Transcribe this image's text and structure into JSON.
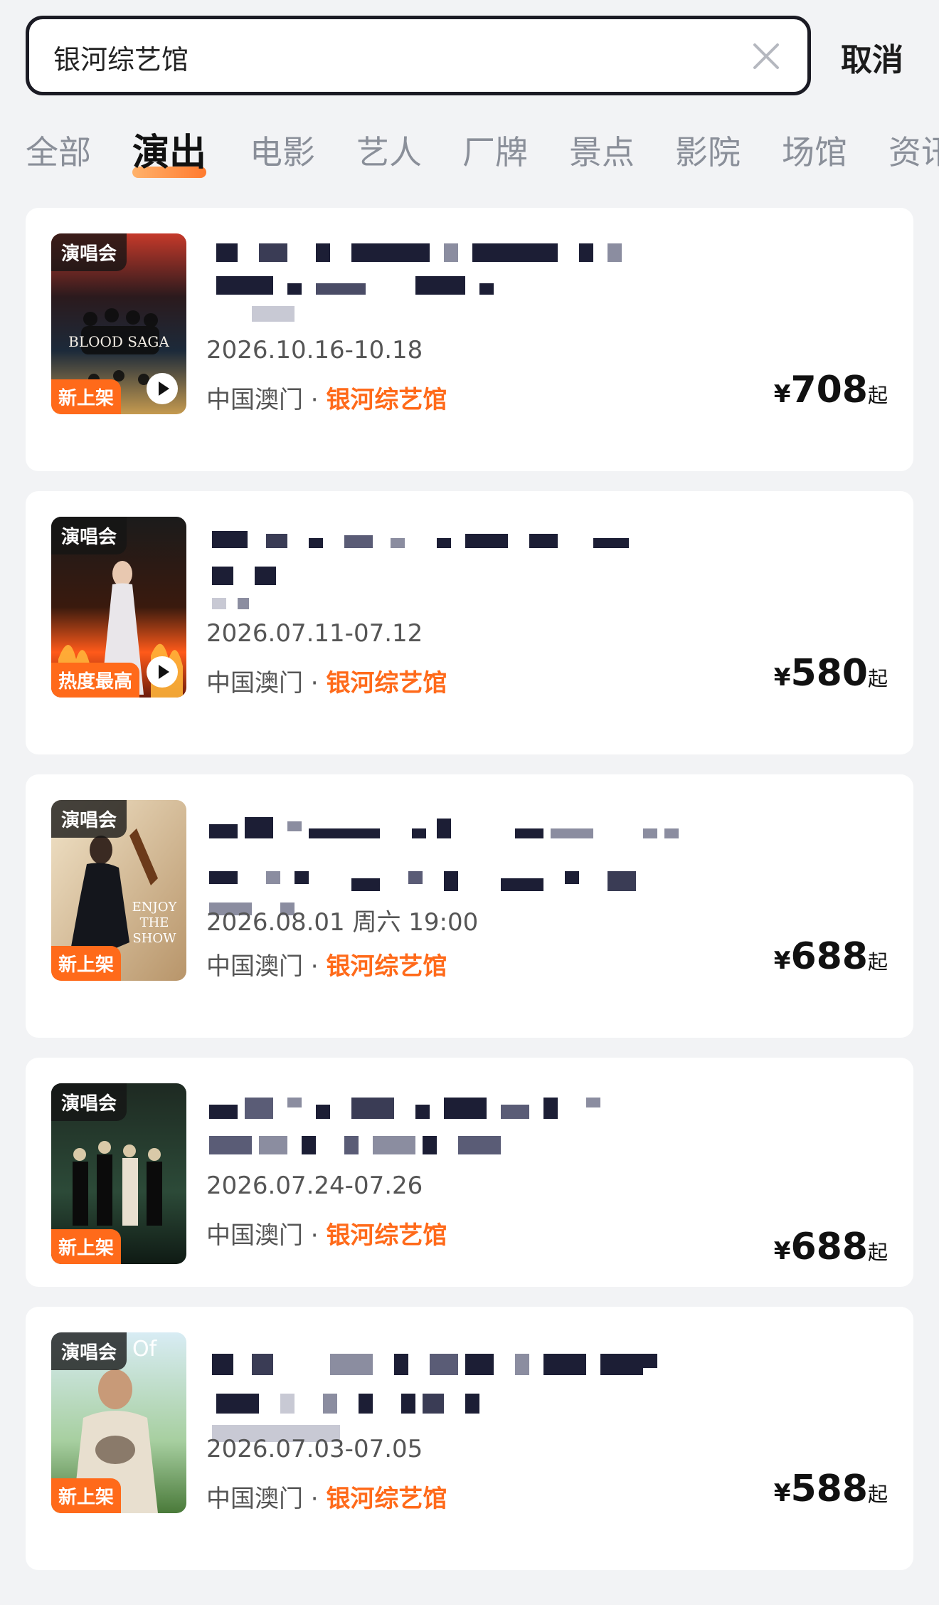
{
  "search": {
    "value": "银河综艺馆",
    "cancel_label": "取消"
  },
  "tabs": [
    {
      "label": "全部"
    },
    {
      "label": "演出",
      "active": true
    },
    {
      "label": "电影"
    },
    {
      "label": "艺人"
    },
    {
      "label": "厂牌"
    },
    {
      "label": "景点"
    },
    {
      "label": "影院"
    },
    {
      "label": "场馆"
    },
    {
      "label": "资讯"
    }
  ],
  "results": [
    {
      "category_tag": "演唱会",
      "badge": "新上架",
      "has_video": true,
      "poster_text": "BLOOD SAGA",
      "date": "2026.10.16-10.18",
      "region": "中国澳门",
      "venue": "银河综艺馆",
      "price_currency": "¥",
      "price": "708",
      "price_suffix": "起"
    },
    {
      "category_tag": "演唱会",
      "badge": "热度最高",
      "has_video": true,
      "poster_text": "",
      "date": "2026.07.11-07.12",
      "region": "中国澳门",
      "venue": "银河综艺馆",
      "price_currency": "¥",
      "price": "580",
      "price_suffix": "起"
    },
    {
      "category_tag": "演唱会",
      "badge": "新上架",
      "has_video": false,
      "poster_text": "ENJOY THE SHOW",
      "date": "2026.08.01 周六 19:00",
      "region": "中国澳门",
      "venue": "银河综艺馆",
      "price_currency": "¥",
      "price": "688",
      "price_suffix": "起"
    },
    {
      "category_tag": "演唱会",
      "badge": "新上架",
      "has_video": false,
      "poster_text": "",
      "date": "2026.07.24-07.26",
      "region": "中国澳门",
      "venue": "银河综艺馆",
      "price_currency": "¥",
      "price": "688",
      "price_suffix": "起"
    },
    {
      "category_tag": "演唱会",
      "badge": "新上架",
      "has_video": false,
      "poster_text": "Of",
      "date": "2026.07.03-07.05",
      "region": "中国澳门",
      "venue": "银河综艺馆",
      "price_currency": "¥",
      "price": "588",
      "price_suffix": "起"
    }
  ],
  "colors": {
    "accent": "#ff6a1a",
    "background": "#f2f3f5",
    "tab_indicator": "#ff7a2f"
  }
}
